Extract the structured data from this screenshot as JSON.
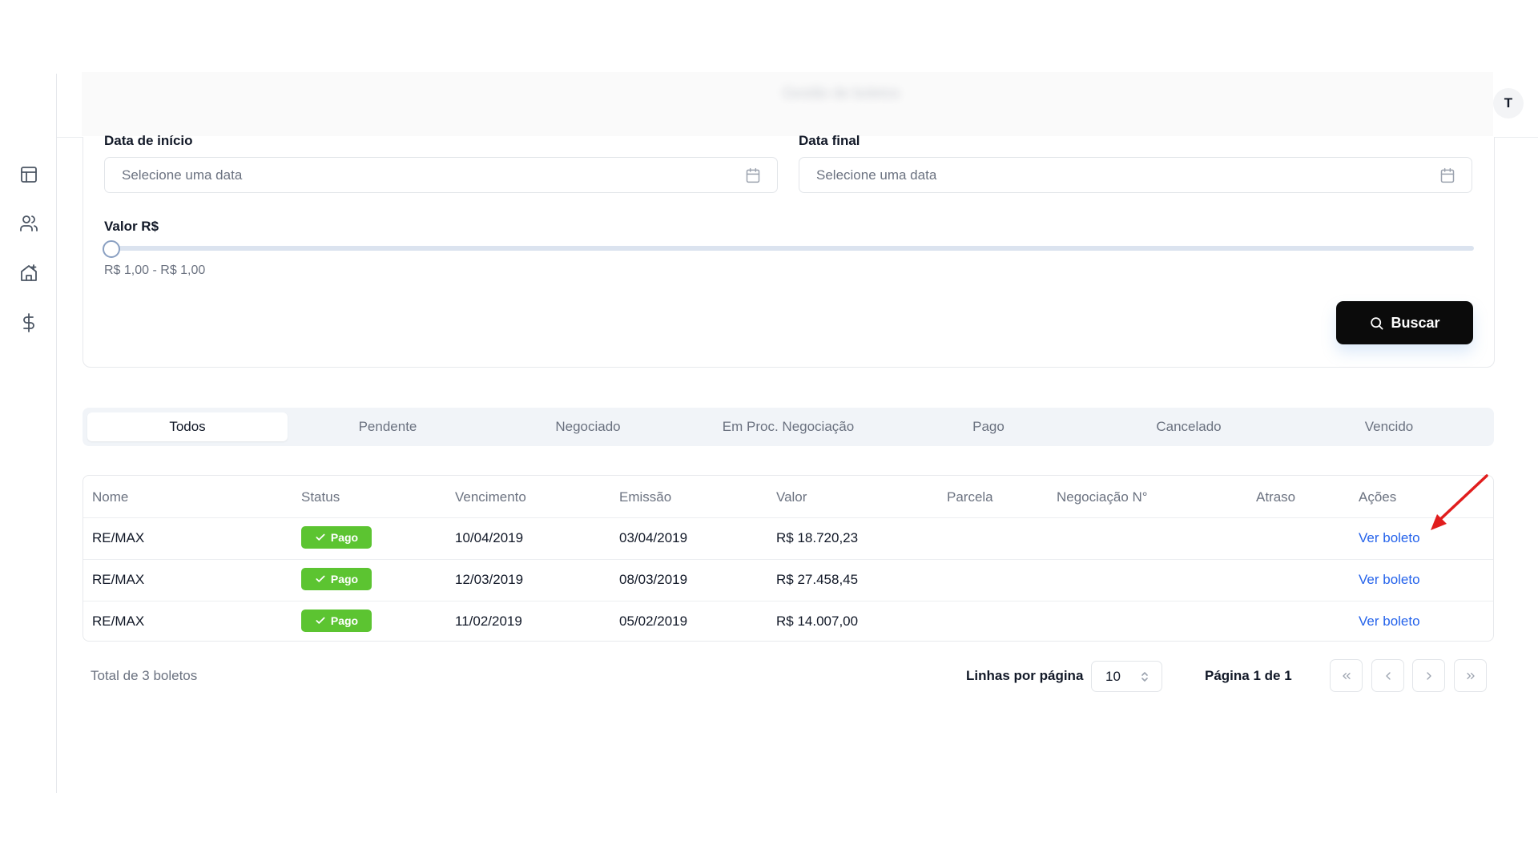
{
  "header": {
    "title": "Gestão de boletos",
    "avatar_initial": "T"
  },
  "sidebar": {
    "items": [
      {
        "name": "dashboard",
        "icon": "layout-icon"
      },
      {
        "name": "users",
        "icon": "users-icon"
      },
      {
        "name": "properties",
        "icon": "house-plus-icon"
      },
      {
        "name": "financial",
        "icon": "dollar-icon"
      }
    ]
  },
  "filters": {
    "start_date_label": "Data de início",
    "start_date_placeholder": "Selecione uma data",
    "end_date_label": "Data final",
    "end_date_placeholder": "Selecione uma data",
    "value_label": "Valor R$",
    "value_range_text": "R$ 1,00 - R$ 1,00",
    "slider_level": 0,
    "search_button": "Buscar"
  },
  "tabs": [
    {
      "label": "Todos",
      "active": true
    },
    {
      "label": "Pendente",
      "active": false
    },
    {
      "label": "Negociado",
      "active": false
    },
    {
      "label": "Em Proc. Negociação",
      "active": false
    },
    {
      "label": "Pago",
      "active": false
    },
    {
      "label": "Cancelado",
      "active": false
    },
    {
      "label": "Vencido",
      "active": false
    }
  ],
  "table": {
    "headers": [
      "Nome",
      "Status",
      "Vencimento",
      "Emissão",
      "Valor",
      "Parcela",
      "Negociação N°",
      "Atraso",
      "Ações"
    ],
    "rows": [
      {
        "nome": "RE/MAX",
        "status": "Pago",
        "vencimento": "10/04/2019",
        "emissao": "03/04/2019",
        "valor": "R$ 18.720,23",
        "acao": "Ver boleto"
      },
      {
        "nome": "RE/MAX",
        "status": "Pago",
        "vencimento": "12/03/2019",
        "emissao": "08/03/2019",
        "valor": "R$ 27.458,45",
        "acao": "Ver boleto"
      },
      {
        "nome": "RE/MAX",
        "status": "Pago",
        "vencimento": "11/02/2019",
        "emissao": "05/02/2019",
        "valor": "R$ 14.007,00",
        "acao": "Ver boleto"
      }
    ]
  },
  "footer": {
    "total_text": "Total de 3 boletos",
    "rows_per_page_label": "Linhas por página",
    "rows_per_page_value": "10",
    "page_info": "Página 1 de 1"
  },
  "colors": {
    "status_paid": "#5cc431",
    "link": "#2563eb",
    "annotation_arrow": "#e11d1d"
  }
}
